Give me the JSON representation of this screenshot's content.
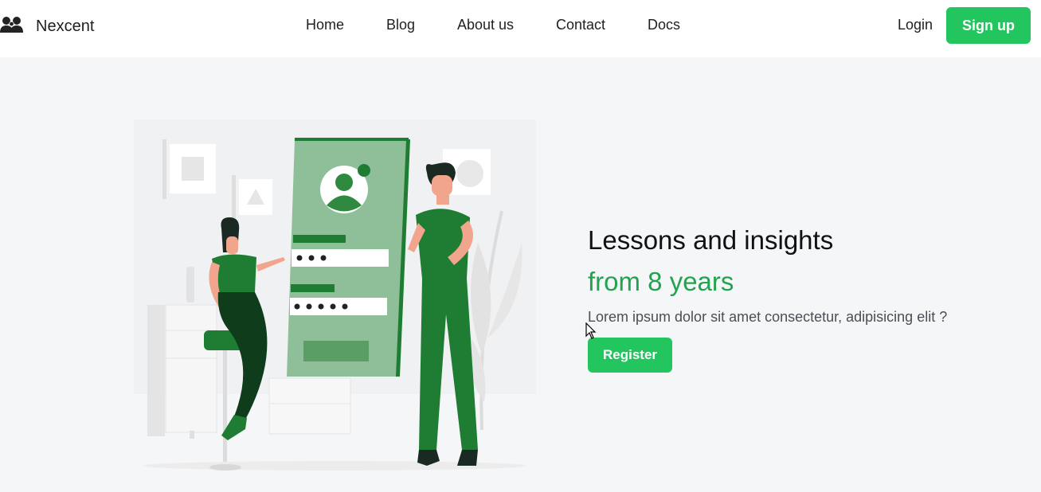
{
  "header": {
    "brand": "Nexcent",
    "nav": [
      "Home",
      "Blog",
      "About us",
      "Contact",
      "Docs"
    ],
    "login_label": "Login",
    "signup_label": "Sign up"
  },
  "hero": {
    "title_line1": "Lessons and insights",
    "title_line2": "from 8 years",
    "description": "Lorem ipsum dolor sit amet consectetur, adipisicing elit ?",
    "register_label": "Register"
  },
  "colors": {
    "accent": "#22c55e",
    "accent_text": "#22a34f",
    "illustration_green": "#1e7d32",
    "page_bg": "#f5f6f8"
  },
  "icons": [
    "users-icon",
    "mouse-cursor-icon"
  ]
}
